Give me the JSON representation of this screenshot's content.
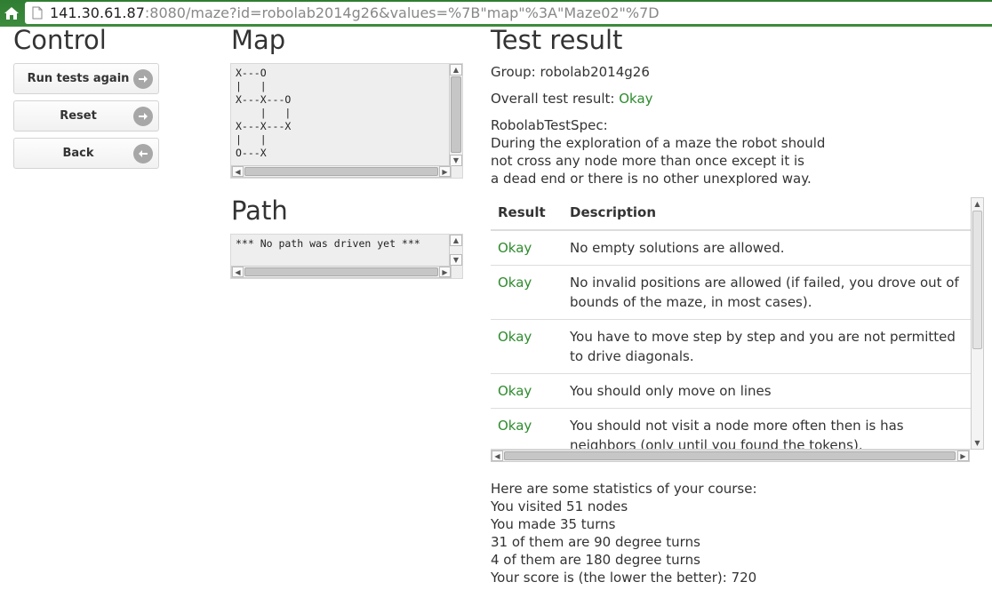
{
  "browser": {
    "url_host": "141.30.61.87",
    "url_rest": ":8080/maze?id=robolab2014g26&values=%7B\"map\"%3A\"Maze02\"%7D"
  },
  "control": {
    "title": "Control",
    "buttons": [
      {
        "label": "Run tests again",
        "icon": "arrow-right-icon"
      },
      {
        "label": "Reset",
        "icon": "arrow-right-icon"
      },
      {
        "label": "Back",
        "icon": "arrow-left-icon"
      }
    ]
  },
  "map": {
    "title": "Map",
    "content": "X---O\n|   |\nX---X---O\n    |   |\nX---X---X\n|   |\nO---X"
  },
  "path": {
    "title": "Path",
    "content": "*** No path was driven yet ***"
  },
  "test_result": {
    "title": "Test result",
    "group_label": "Group: robolab2014g26",
    "overall_label": "Overall test result: ",
    "overall_value": "Okay",
    "spec_name": "RobolabTestSpec:",
    "spec_lines": [
      "During the exploration of a maze the robot should",
      "not cross any node more than once except it is",
      "a dead end or there is no other unexplored way."
    ],
    "table_headers": [
      "Result",
      "Description"
    ],
    "rows": [
      {
        "result": "Okay",
        "description": "No empty solutions are allowed."
      },
      {
        "result": "Okay",
        "description": "No invalid positions are allowed (if failed, you drove out of bounds of the maze, in most cases)."
      },
      {
        "result": "Okay",
        "description": "You have to move step by step and you are not permitted to drive diagonals."
      },
      {
        "result": "Okay",
        "description": "You should only move on lines"
      },
      {
        "result": "Okay",
        "description": "You should not visit a node more often then is has neighbors (only until you found the tokens)."
      }
    ]
  },
  "stats": {
    "lines": [
      "Here are some statistics of your course:",
      "You visited 51 nodes",
      "You made 35 turns",
      "31 of them are 90 degree turns",
      "4 of them are 180 degree turns",
      "Your score is (the lower the better): 720"
    ]
  }
}
